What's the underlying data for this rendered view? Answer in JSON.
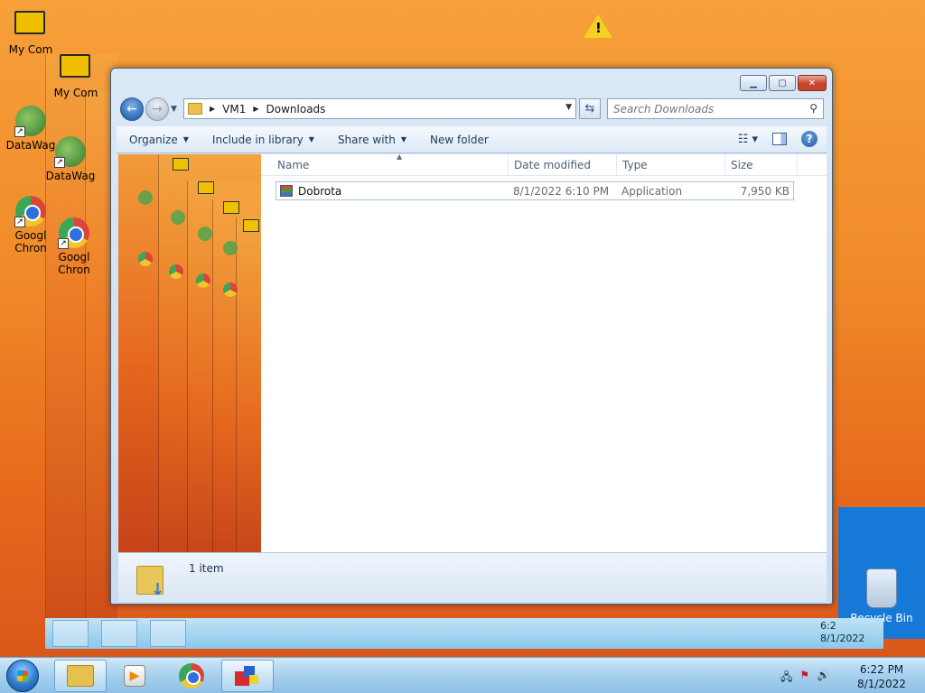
{
  "desktop": {
    "icons": [
      {
        "label": "My Com"
      },
      {
        "label": "DataWag"
      },
      {
        "label": "Googl Chron"
      }
    ],
    "recycle_bin_label": "Recycle Bin"
  },
  "window": {
    "address": {
      "parts": [
        "VM1",
        "Downloads"
      ]
    },
    "search": {
      "placeholder": "Search Downloads"
    },
    "toolbar": {
      "organize": "Organize",
      "include_in_library": "Include in library",
      "share_with": "Share with",
      "new_folder": "New folder"
    },
    "columns": {
      "name": "Name",
      "date_modified": "Date modified",
      "type": "Type",
      "size": "Size"
    },
    "files": [
      {
        "name": "Dobrota",
        "date_modified": "8/1/2022 6:10 PM",
        "type": "Application",
        "size": "7,950 KB"
      }
    ],
    "status": {
      "item_count": "1 item"
    }
  },
  "ghost_taskbar": {
    "clock_time": "6:2",
    "clock_date": "8/1/2022"
  },
  "taskbar": {
    "clock_time": "6:22 PM",
    "clock_date": "8/1/2022"
  },
  "colors": {
    "desktop_orange": "#f08a2a",
    "taskbar_blue": "#a9d2ef",
    "window_frame": "#c9dcf0",
    "recycle_panel": "#1679d8"
  }
}
